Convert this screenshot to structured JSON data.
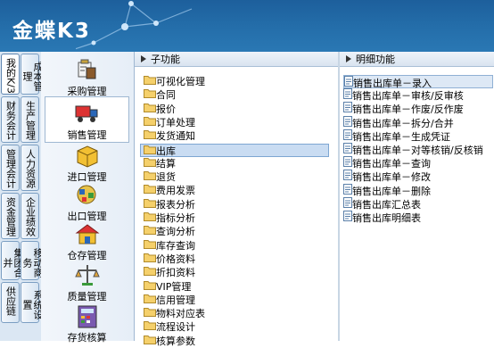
{
  "header": {
    "logo_text": "金蝶K3"
  },
  "left_tabs": {
    "col1": [
      "我的K/3",
      "财务会计",
      "管理会计",
      "资金管理",
      "集团合并",
      "供应链"
    ],
    "col2": [
      "成本管理",
      "生产管理",
      "人力资源",
      "企业绩效",
      "移动商务",
      "系统设置"
    ]
  },
  "modules": [
    {
      "label": "采购管理",
      "icon": "purchase-icon"
    },
    {
      "label": "销售管理",
      "icon": "truck-icon",
      "selected": true
    },
    {
      "label": "进口管理",
      "icon": "box-icon"
    },
    {
      "label": "出口管理",
      "icon": "export-icon"
    },
    {
      "label": "仓存管理",
      "icon": "warehouse-icon"
    },
    {
      "label": "质量管理",
      "icon": "scale-icon"
    },
    {
      "label": "存货核算",
      "icon": "calculator-icon"
    }
  ],
  "sub_function": {
    "title": "子功能",
    "items": [
      "可视化管理",
      "合同",
      "报价",
      "订单处理",
      "发货通知",
      "出库",
      "结算",
      "退货",
      "费用发票",
      "报表分析",
      "指标分析",
      "查询分析",
      "库存查询",
      "价格资料",
      "折扣资料",
      "VIP管理",
      "信用管理",
      "物料对应表",
      "流程设计",
      "核算参数"
    ],
    "selected": "出库"
  },
  "detail_function": {
    "title": "明细功能",
    "items": [
      "销售出库单－录入",
      "销售出库单－审核/反审核",
      "销售出库单－作废/反作废",
      "销售出库单－拆分/合并",
      "销售出库单－生成凭证",
      "销售出库单－对等核销/反核销",
      "销售出库单－查询",
      "销售出库单－修改",
      "销售出库单－删除",
      "销售出库汇总表",
      "销售出库明细表"
    ],
    "selected": "销售出库单－录入"
  }
}
